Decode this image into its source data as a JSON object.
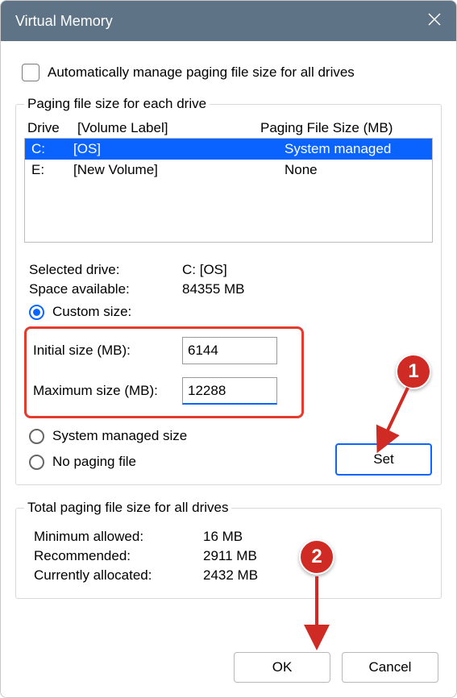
{
  "window": {
    "title": "Virtual Memory"
  },
  "checkbox": {
    "label": "Automatically manage paging file size for all drives",
    "checked": false
  },
  "drives_group": {
    "legend": "Paging file size for each drive",
    "headers": {
      "drive": "Drive",
      "label": "[Volume Label]",
      "size": "Paging File Size (MB)"
    },
    "rows": [
      {
        "drive": "C:",
        "label": "[OS]",
        "size": "System managed",
        "selected": true
      },
      {
        "drive": "E:",
        "label": "[New Volume]",
        "size": "None",
        "selected": false
      }
    ]
  },
  "selected_drive": {
    "label": "Selected drive:",
    "value": "C:  [OS]"
  },
  "space": {
    "label": "Space available:",
    "value": "84355 MB"
  },
  "size_mode": {
    "custom_label": "Custom size:",
    "system_label": "System managed size",
    "none_label": "No paging file",
    "value": "custom"
  },
  "custom": {
    "initial_label": "Initial size (MB):",
    "initial_value": "6144",
    "max_label": "Maximum size (MB):",
    "max_value": "12288"
  },
  "set_button": "Set",
  "totals": {
    "legend": "Total paging file size for all drives",
    "min": {
      "label": "Minimum allowed:",
      "value": "16 MB"
    },
    "rec": {
      "label": "Recommended:",
      "value": "2911 MB"
    },
    "cur": {
      "label": "Currently allocated:",
      "value": "2432 MB"
    }
  },
  "footer": {
    "ok": "OK",
    "cancel": "Cancel"
  },
  "annotations": {
    "badge1": "1",
    "badge2": "2"
  }
}
